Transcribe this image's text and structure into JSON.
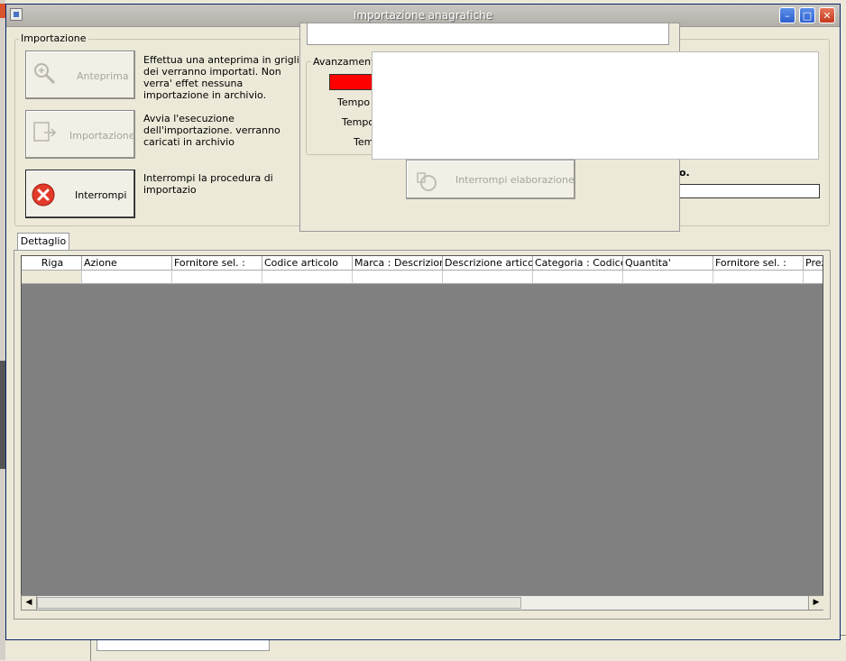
{
  "window": {
    "title": "Importazione anagrafiche"
  },
  "importazione": {
    "group_label": "Importazione",
    "buttons": [
      {
        "label": "Anteprima",
        "description": "Effettua una anteprima in griglia dei verranno importati. Non verra' effet nessuna importazione in archivio."
      },
      {
        "label": "Importazione",
        "description": "Avvia l'esecuzione dell'importazione. verranno caricati in archivio"
      },
      {
        "label": "Interrompi",
        "description": "Interrompi la procedura di importazio"
      }
    ]
  },
  "progress": {
    "group_label": "Avanzamento",
    "labels": [
      "Tempo t",
      "Tempo",
      "Tem"
    ],
    "stop_button": "Interrompi elaborazione",
    "bar_color": "#ff0000",
    "trail_text": "o."
  },
  "tab": {
    "label": "Dettaglio"
  },
  "grid": {
    "columns": [
      "Riga",
      "Azione",
      "Fornitore sel. :",
      "Codice articolo",
      "Marca : Descrizione",
      "Descrizione articolo",
      "Categoria : Codice",
      "Quantita'",
      "Fornitore sel. :",
      "Prez"
    ]
  }
}
